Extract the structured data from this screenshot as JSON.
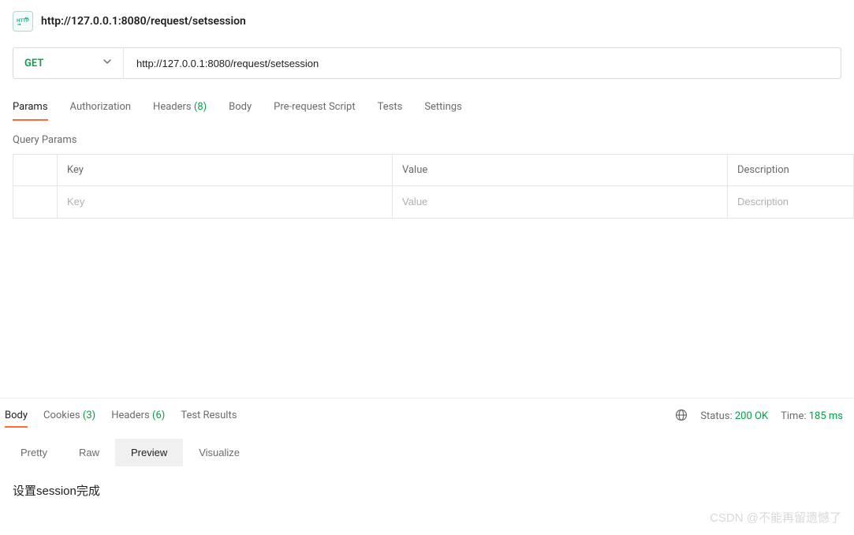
{
  "header": {
    "title": "http://127.0.0.1:8080/request/setsession"
  },
  "request": {
    "method": "GET",
    "url": "http://127.0.0.1:8080/request/setsession"
  },
  "tabs": {
    "params": "Params",
    "authorization": "Authorization",
    "headers_label": "Headers",
    "headers_count": "(8)",
    "body": "Body",
    "prerequest": "Pre-request Script",
    "tests": "Tests",
    "settings": "Settings"
  },
  "params_section": {
    "label": "Query Params",
    "columns": {
      "key": "Key",
      "value": "Value",
      "description": "Description"
    },
    "placeholders": {
      "key": "Key",
      "value": "Value",
      "description": "Description"
    }
  },
  "response_tabs": {
    "body": "Body",
    "cookies_label": "Cookies",
    "cookies_count": "(3)",
    "headers_label": "Headers",
    "headers_count": "(6)",
    "test_results": "Test Results"
  },
  "status": {
    "status_label": "Status:",
    "status_value": "200 OK",
    "time_label": "Time:",
    "time_value": "185 ms"
  },
  "view_tabs": {
    "pretty": "Pretty",
    "raw": "Raw",
    "preview": "Preview",
    "visualize": "Visualize"
  },
  "preview": {
    "content": "设置session完成"
  },
  "watermark": "CSDN @不能再留遗憾了"
}
